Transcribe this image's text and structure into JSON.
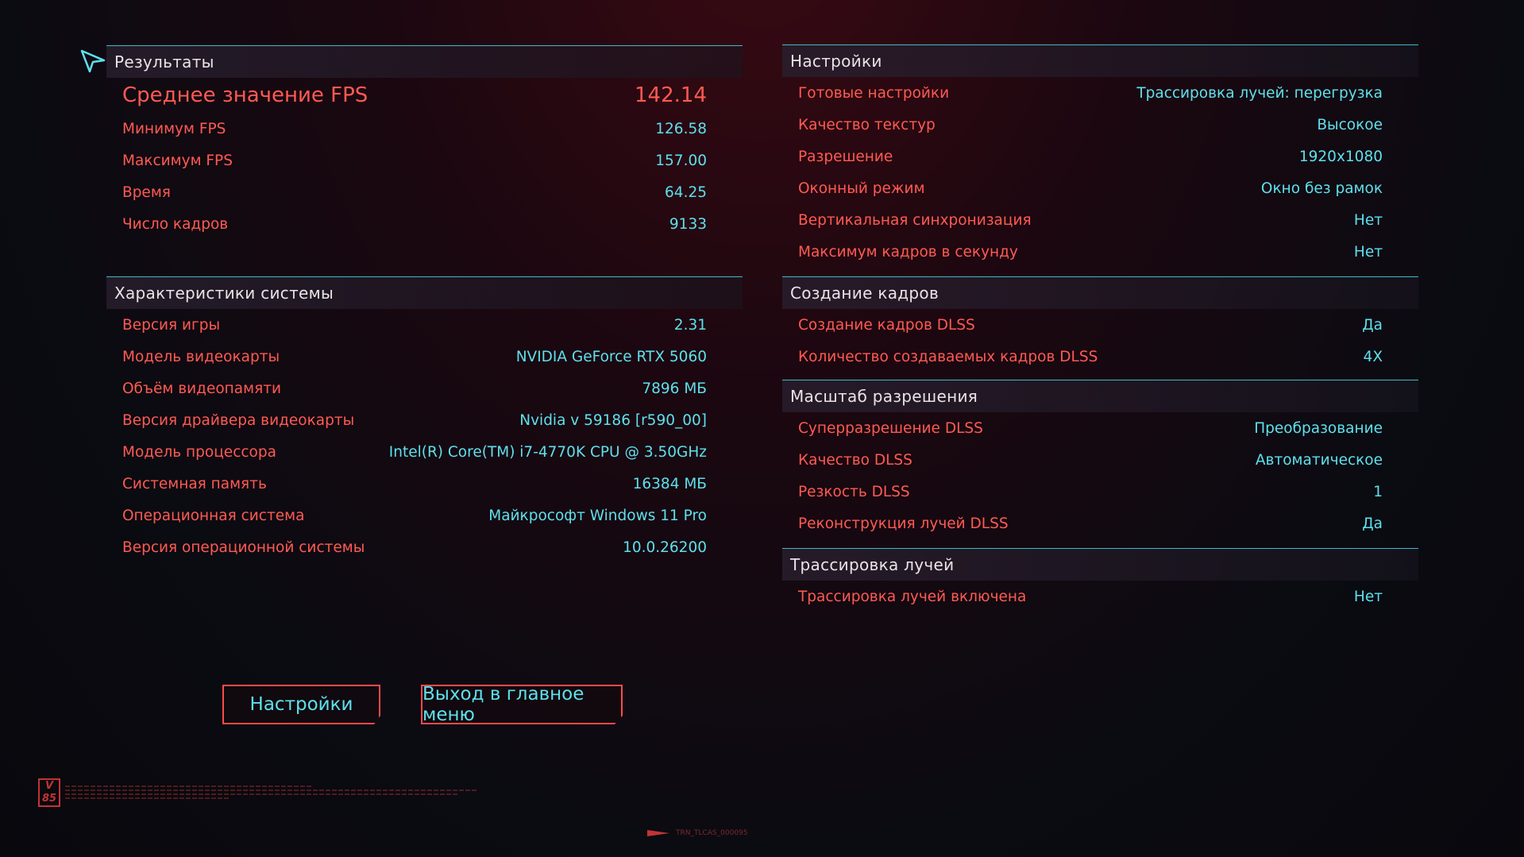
{
  "results": {
    "title": "Результаты",
    "rows": [
      {
        "label": "Среднее значение FPS",
        "value": "142.14"
      },
      {
        "label": "Минимум FPS",
        "value": "126.58"
      },
      {
        "label": "Максимум FPS",
        "value": "157.00"
      },
      {
        "label": "Время",
        "value": "64.25"
      },
      {
        "label": "Число кадров",
        "value": "9133"
      }
    ]
  },
  "system": {
    "title": "Характеристики системы",
    "rows": [
      {
        "label": "Версия игры",
        "value": "2.31"
      },
      {
        "label": "Модель видеокарты",
        "value": "NVIDIA GeForce RTX 5060"
      },
      {
        "label": "Объём видеопамяти",
        "value": "7896 МБ"
      },
      {
        "label": "Версия драйвера видеокарты",
        "value": "Nvidia v 59186 [r590_00]"
      },
      {
        "label": "Модель процессора",
        "value": "Intel(R) Core(TM) i7-4770K CPU @ 3.50GHz"
      },
      {
        "label": "Системная память",
        "value": "16384 МБ"
      },
      {
        "label": "Операционная система",
        "value": "Майкрософт Windows 11 Pro"
      },
      {
        "label": "Версия операционной системы",
        "value": "10.0.26200"
      }
    ]
  },
  "settings": {
    "title": "Настройки",
    "rows": [
      {
        "label": "Готовые настройки",
        "value": "Трассировка лучей: перегрузка"
      },
      {
        "label": "Качество текстур",
        "value": "Высокое"
      },
      {
        "label": "Разрешение",
        "value": "1920x1080"
      },
      {
        "label": "Оконный режим",
        "value": "Окно без рамок"
      },
      {
        "label": "Вертикальная синхронизация",
        "value": "Нет"
      },
      {
        "label": "Максимум кадров в секунду",
        "value": "Нет"
      }
    ]
  },
  "frame_gen": {
    "title": "Создание кадров",
    "rows": [
      {
        "label": "Создание кадров DLSS",
        "value": "Да"
      },
      {
        "label": "Количество создаваемых кадров DLSS",
        "value": "4X"
      }
    ]
  },
  "scaling": {
    "title": "Масштаб разрешения",
    "rows": [
      {
        "label": "Суперразрешение DLSS",
        "value": "Преобразование"
      },
      {
        "label": "Качество DLSS",
        "value": "Автоматическое"
      },
      {
        "label": "Резкость DLSS",
        "value": "1"
      },
      {
        "label": "Реконструкция лучей DLSS",
        "value": "Да"
      }
    ]
  },
  "raytracing": {
    "title": "Трассировка лучей",
    "rows": [
      {
        "label": "Трассировка лучей включена",
        "value": "Нет"
      }
    ]
  },
  "buttons": {
    "settings": "Настройки",
    "exit": "Выход в главное меню"
  },
  "footer": {
    "logo": "V 85",
    "tag": "TRN_TLCAS_000095"
  },
  "colors": {
    "label": "#ff5a52",
    "value": "#5ee0ec",
    "header_line": "#3fb9c7",
    "button_border": "#ff4b4b"
  }
}
